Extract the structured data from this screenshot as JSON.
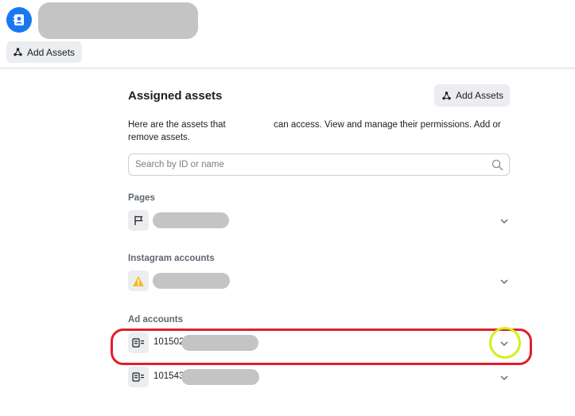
{
  "header": {
    "add_assets_label": "Add Assets"
  },
  "main": {
    "title": "Assigned assets",
    "add_assets_label": "Add Assets",
    "description_before": "Here are the assets that",
    "description_after": "can access. View and manage their permissions. Add or remove assets.",
    "search_placeholder": "Search by ID or name"
  },
  "groups": {
    "pages_label": "Pages",
    "instagram_label": "Instagram accounts",
    "ad_accounts_label": "Ad accounts"
  },
  "ad_accounts": [
    {
      "id_visible": "101502"
    },
    {
      "id_visible": "101543"
    }
  ],
  "icons": {
    "avatar": "person-badge-icon",
    "add_assets": "share-nodes-icon",
    "search": "magnifier-icon",
    "page": "flag-icon",
    "instagram": "warning-icon",
    "ad_account": "ad-account-icon",
    "expand": "chevron-down-icon"
  },
  "colors": {
    "brand": "#1877f2",
    "warning": "#f7b928",
    "highlight_box": "#e0202a",
    "highlight_circle": "#d4ef18"
  }
}
